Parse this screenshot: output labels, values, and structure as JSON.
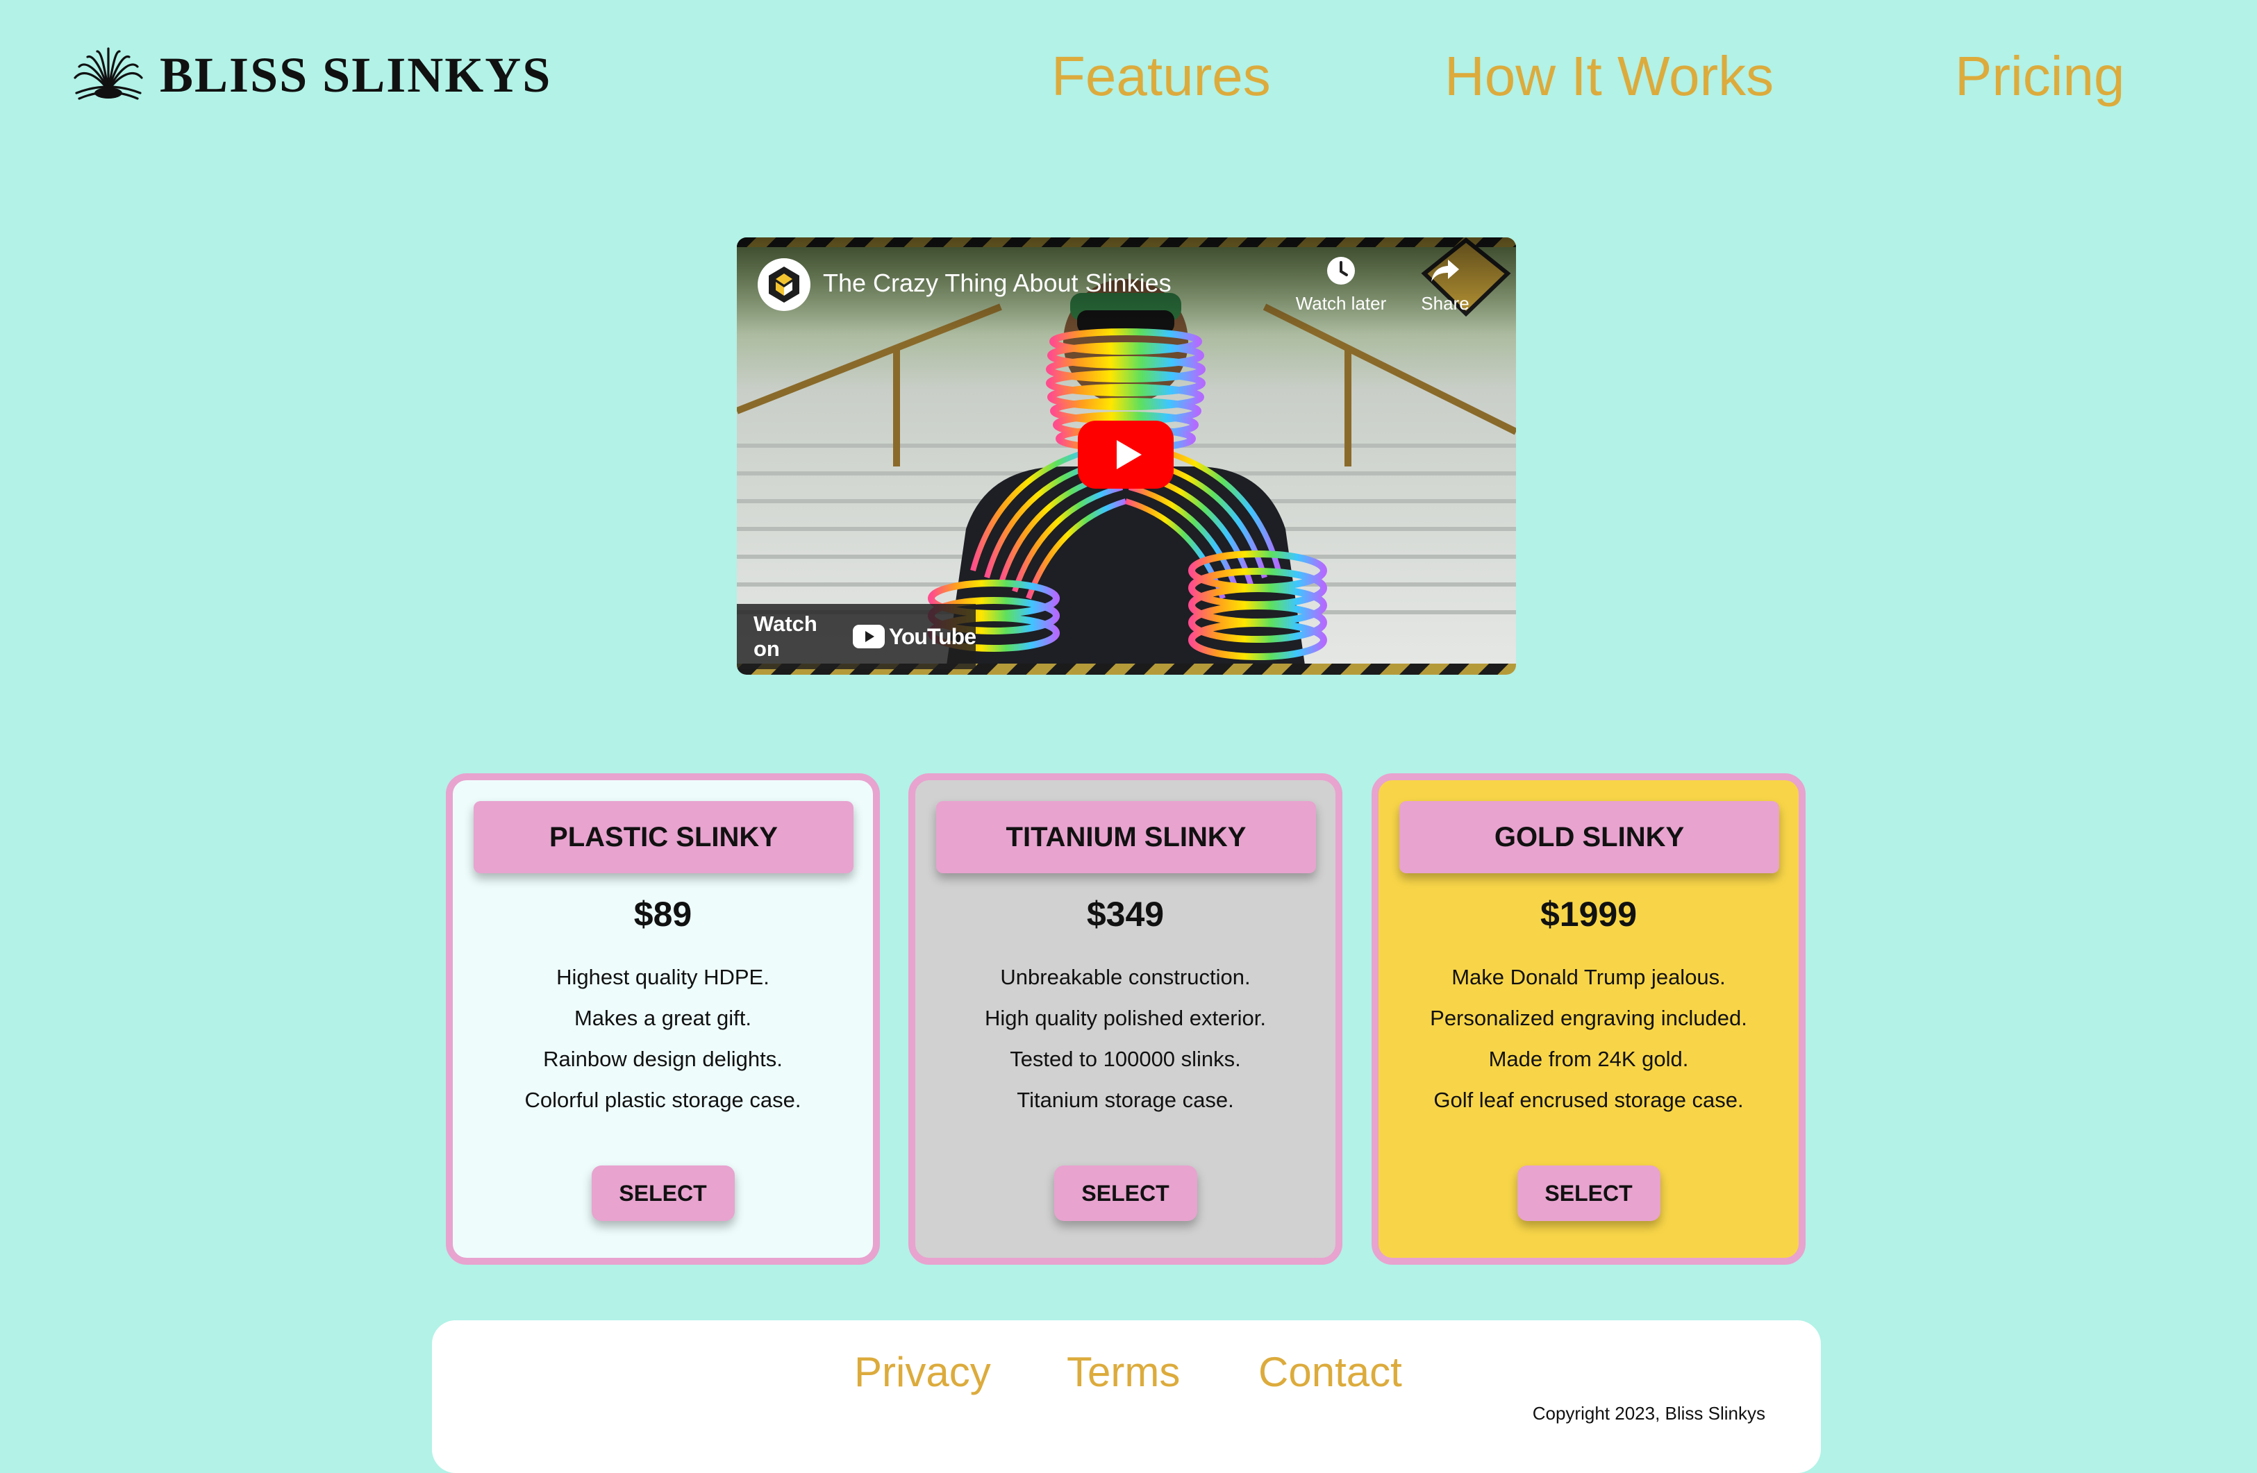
{
  "header": {
    "brand": "BLISS SLINKYS",
    "logo_icon": "slinky-fan-icon",
    "nav": [
      {
        "label": "Features"
      },
      {
        "label": "How It Works"
      },
      {
        "label": "Pricing"
      }
    ]
  },
  "video": {
    "title": "The Crazy Thing About Slinkies",
    "watch_later_label": "Watch later",
    "share_label": "Share",
    "watch_on_label": "Watch on",
    "platform_label": "YouTube"
  },
  "plans": [
    {
      "name": "PLASTIC SLINKY",
      "price": "$89",
      "features": [
        "Highest quality HDPE.",
        "Makes a great gift.",
        "Rainbow design delights.",
        "Colorful plastic storage case."
      ],
      "button_label": "SELECT",
      "background": "#eefcfc"
    },
    {
      "name": "TITANIUM SLINKY",
      "price": "$349",
      "features": [
        "Unbreakable construction.",
        "High quality polished exterior.",
        "Tested to 100000 slinks.",
        "Titanium storage case."
      ],
      "button_label": "SELECT",
      "background": "#d1d1d1"
    },
    {
      "name": "GOLD SLINKY",
      "price": "$1999",
      "features": [
        "Make Donald Trump jealous.",
        "Personalized engraving included.",
        "Made from 24K gold.",
        "Golf leaf encrused storage case."
      ],
      "button_label": "SELECT",
      "background": "#f8d548"
    }
  ],
  "footer": {
    "links": [
      {
        "label": "Privacy"
      },
      {
        "label": "Terms"
      },
      {
        "label": "Contact"
      }
    ],
    "copyright": "Copyright 2023, Bliss Slinkys"
  },
  "colors": {
    "page_background": "#b2f2e7",
    "accent_gold": "#dcab3c",
    "card_pink": "#e8a3cf",
    "youtube_red": "#ff0000"
  }
}
